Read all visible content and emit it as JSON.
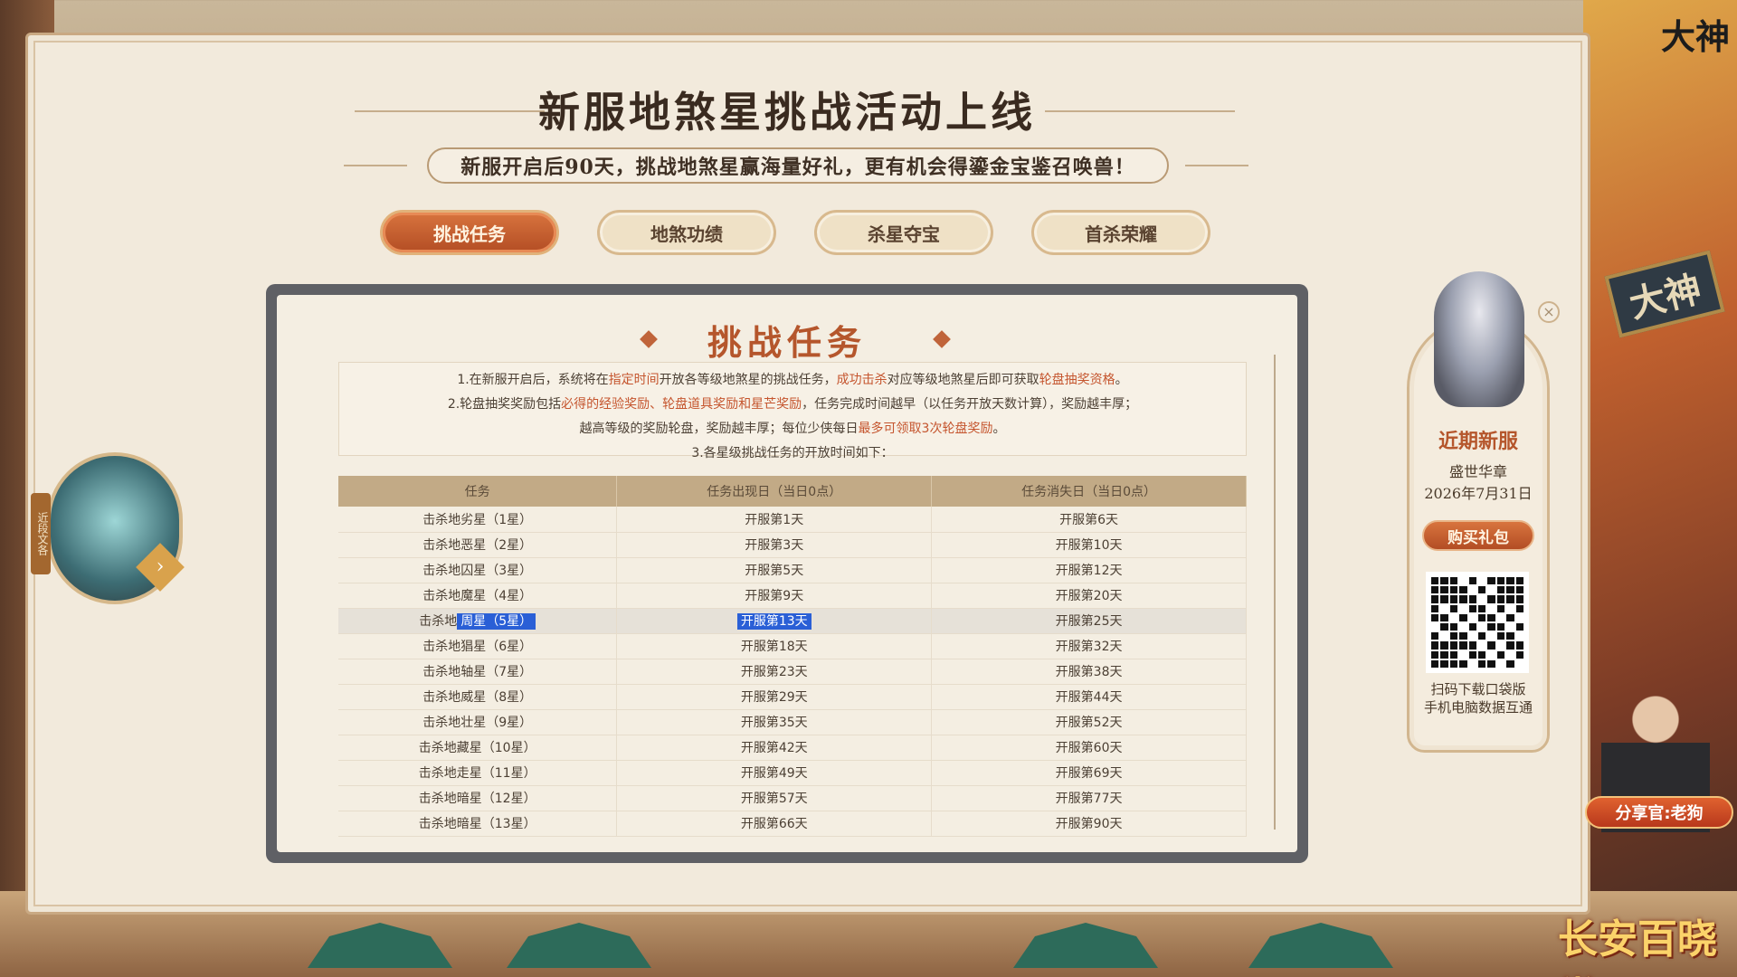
{
  "top_logo": "大神",
  "background_sign": "大神",
  "header": {
    "title": "新服地煞星挑战活动上线",
    "subtitle": "新服开启后90天，挑战地煞星赢海量好礼，更有机会得鎏金宝鉴召唤兽！"
  },
  "tabs": [
    {
      "label": "挑战任务",
      "active": true
    },
    {
      "label": "地煞功绩",
      "active": false
    },
    {
      "label": "杀星夺宝",
      "active": false
    },
    {
      "label": "首杀荣耀",
      "active": false
    }
  ],
  "section": {
    "title": "挑战任务",
    "desc": {
      "line1_a": "1.在新服开启后，系统将在",
      "line1_b": "指定时间",
      "line1_c": "开放各等级地煞星的挑战任务，",
      "line1_d": "成功击杀",
      "line1_e": "对应等级地煞星后即可获取",
      "line1_f": "轮盘抽奖资格",
      "line1_g": "。",
      "line2_a": "2.轮盘抽奖奖励包括",
      "line2_b": "必得的经验奖励、轮盘道具奖励和星芒奖励",
      "line2_c": "，任务完成时间越早（以任务开放天数计算），奖励越丰厚；",
      "line3_a": "越高等级的奖励轮盘，奖励越丰厚；每位少侠每日",
      "line3_b": "最多可领取3次轮盘奖励",
      "line3_c": "。",
      "line4": "3.各星级挑战任务的开放时间如下："
    },
    "table": {
      "headers": [
        "任务",
        "任务出现日（当日0点）",
        "任务消失日（当日0点）"
      ],
      "rows": [
        [
          "击杀地劣星（1星）",
          "开服第1天",
          "开服第6天"
        ],
        [
          "击杀地恶星（2星）",
          "开服第3天",
          "开服第10天"
        ],
        [
          "击杀地囚星（3星）",
          "开服第5天",
          "开服第12天"
        ],
        [
          "击杀地魔星（4星）",
          "开服第9天",
          "开服第20天"
        ],
        [
          "击杀地周星（5星）",
          "开服第13天",
          "开服第25天"
        ],
        [
          "击杀地猖星（6星）",
          "开服第18天",
          "开服第32天"
        ],
        [
          "击杀地轴星（7星）",
          "开服第23天",
          "开服第38天"
        ],
        [
          "击杀地威星（8星）",
          "开服第29天",
          "开服第44天"
        ],
        [
          "击杀地壮星（9星）",
          "开服第35天",
          "开服第52天"
        ],
        [
          "击杀地藏星（10星）",
          "开服第42天",
          "开服第60天"
        ],
        [
          "击杀地走星（11星）",
          "开服第49天",
          "开服第69天"
        ],
        [
          "击杀地暗星（12星）",
          "开服第57天",
          "开服第77天"
        ],
        [
          "击杀地暗星（13星）",
          "开服第66天",
          "开服第90天"
        ]
      ],
      "selected_row_index": 4,
      "selected_name_prefix": "击杀地",
      "selected_name_highlight": "周星（5星）"
    }
  },
  "left_avatar": {
    "tag": "近段文各"
  },
  "right_card": {
    "close": "×",
    "heading": "近期新服",
    "server": "盛世华章",
    "date": "2026年7月31日",
    "button": "购买礼包",
    "note1": "扫码下载口袋版",
    "note2": "手机电脑数据互通"
  },
  "host": {
    "badge": "分享官:老狗"
  },
  "brand": "长安百晓堂",
  "colors": {
    "accent": "#b5562c",
    "tab_active": "#c45d2e",
    "table_header": "#c2aa86",
    "selection": "#2a5fd6"
  }
}
